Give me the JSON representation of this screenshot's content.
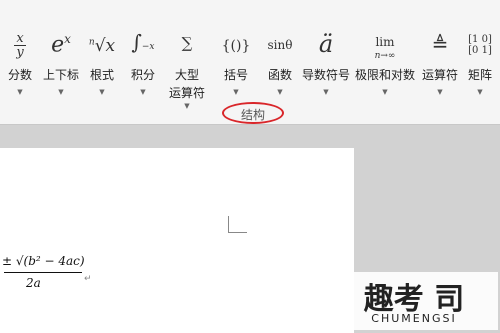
{
  "ribbon": {
    "group_label": "结构",
    "buttons": [
      {
        "id": "fraction",
        "icon": "x/y",
        "label": "分数",
        "label2": ""
      },
      {
        "id": "script",
        "icon": "eˣ",
        "label": "上下标",
        "label2": ""
      },
      {
        "id": "radical",
        "icon": "ⁿ√x",
        "label": "根式",
        "label2": ""
      },
      {
        "id": "integral",
        "icon": "∫",
        "label": "积分",
        "label2": ""
      },
      {
        "id": "large-operator",
        "icon": "∑",
        "label": "大型",
        "label2": "运算符"
      },
      {
        "id": "bracket",
        "icon": "{()}",
        "label": "括号",
        "label2": ""
      },
      {
        "id": "function",
        "icon": "sinθ",
        "label": "函数",
        "label2": ""
      },
      {
        "id": "accent",
        "icon": "ä",
        "label": "导数符号",
        "label2": ""
      },
      {
        "id": "limit-log",
        "icon": "lim",
        "label": "极限和对数",
        "label2": ""
      },
      {
        "id": "operator",
        "icon": "≜",
        "label": "运算符",
        "label2": ""
      },
      {
        "id": "matrix",
        "icon": "[10 01]",
        "label": "矩阵",
        "label2": ""
      }
    ]
  },
  "document": {
    "equation_numerator": "± √(b² − 4ac)",
    "equation_denominator": "2a"
  },
  "watermark": {
    "text": "趣考 司",
    "subtext": "CHUMENGSI"
  }
}
